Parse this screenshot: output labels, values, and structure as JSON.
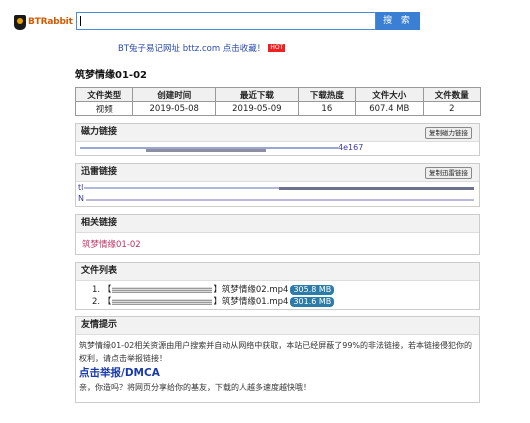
{
  "header": {
    "logo_text": "BTRabbit",
    "search_placeholder": "",
    "search_button_label": "搜 索",
    "notice_text": "BT兔子易记网址 bttz.com 点击收藏！",
    "hot_badge": "HOT"
  },
  "page_title": "筑梦情缘01-02",
  "info_table": {
    "headers": [
      "文件类型",
      "创建时间",
      "最近下载",
      "下载热度",
      "文件大小",
      "文件数量"
    ],
    "values": [
      "视频",
      "2019-05-08",
      "2019-05-09",
      "16",
      "607.4 MB",
      "2"
    ]
  },
  "magnet": {
    "heading": "磁力链接",
    "copy_button_label": "复制磁力链接",
    "visible_text": "4e167"
  },
  "thunder": {
    "heading": "迅雷链接",
    "copy_button_label": "复制迅雷链接",
    "line1_prefix": "tl",
    "line2_prefix": "N"
  },
  "related": {
    "heading": "相关链接",
    "items": [
      "筑梦情缘01-02"
    ]
  },
  "files": {
    "heading": "文件列表",
    "items": [
      {
        "index": "1.",
        "prefix": "【",
        "suffix": "】筑梦情缘02.mp4",
        "size": "305.8 MB"
      },
      {
        "index": "2.",
        "prefix": "【",
        "suffix": "】筑梦情缘01.mp4",
        "size": "301.6 MB"
      }
    ]
  },
  "tips": {
    "heading": "友情提示",
    "paragraph": "筑梦情缘01-02相关资源由用户搜索并自动从网络中获取，本站已经屏蔽了99%的非法链接，若本链接侵犯你的权利，请点击举报链接！",
    "report_link": "点击举报/DMCA",
    "share_text": "亲，你造吗？将网页分享给你的基友，下载的人越多速度越快哦！"
  },
  "colors": {
    "accent": "#3b7fd4",
    "hot": "#ee2222",
    "size_badge": "#2b7ca8",
    "related_link": "#c03060"
  }
}
